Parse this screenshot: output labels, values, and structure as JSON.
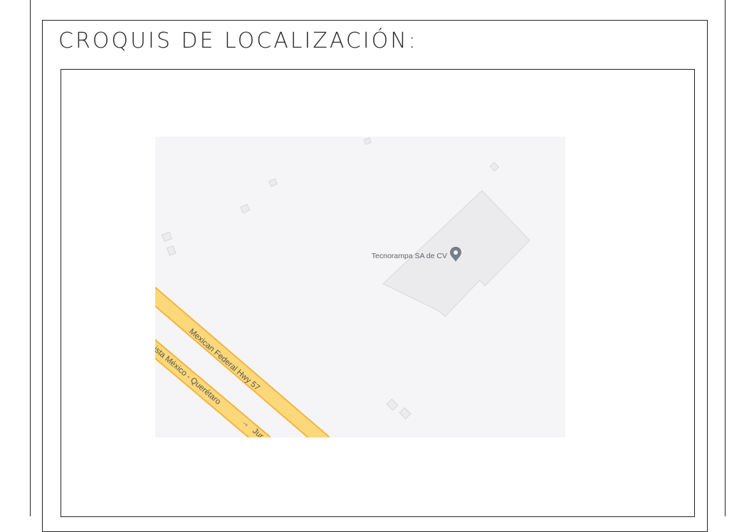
{
  "sheet": {
    "title": "CROQUIS DE LOCALIZACIÓN:"
  },
  "map": {
    "place_label": "Tecnorampa SA de CV",
    "marker_icon": "map-pin-icon",
    "roads": [
      {
        "label": "Mexican Federal Hwy 57"
      },
      {
        "label": "ista México - Querétaro",
        "suffix_label": "Jur"
      }
    ],
    "colors": {
      "background": "#f5f5f7",
      "road_fill": "#fcd87a",
      "road_edge": "#f2b541",
      "building_fill": "#ebebee",
      "building_edge": "#d8d8dd",
      "marker": "#757f8a",
      "label_text": "#5f6368"
    }
  }
}
